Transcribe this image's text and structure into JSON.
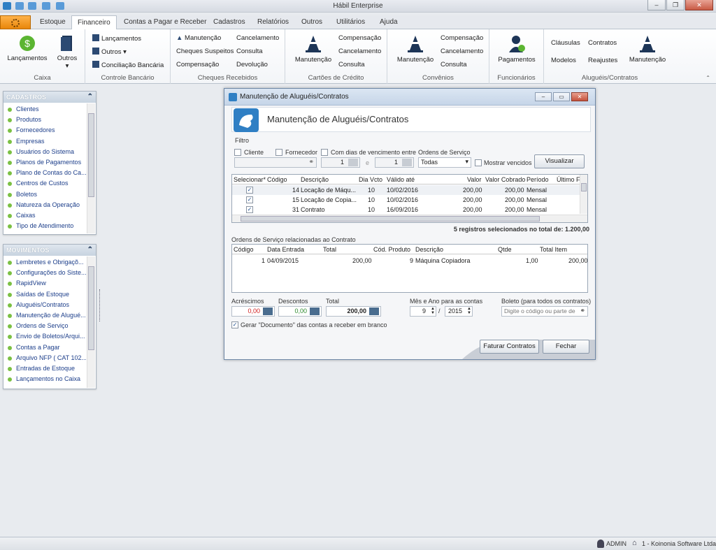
{
  "app": {
    "title": "Hábil Enterprise"
  },
  "menu": {
    "tabs": [
      "Estoque",
      "Financeiro",
      "Contas a Pagar e Receber",
      "Cadastros",
      "Relatórios",
      "Outros",
      "Utilitários",
      "Ajuda"
    ],
    "active": "Financeiro"
  },
  "ribbon": {
    "caixa": {
      "label": "Caixa",
      "lancamentos": "Lançamentos",
      "outros": "Outros"
    },
    "controle": {
      "label": "Controle Bancário",
      "lancamentos": "Lançamentos",
      "outros": "Outros",
      "conciliacao": "Conciliação Bancária"
    },
    "cheques": {
      "label": "Cheques Recebidos",
      "manutencao": "Manutenção",
      "suspeitos": "Cheques Suspeitos",
      "compensacao": "Compensação",
      "cancelamento": "Cancelamento",
      "consulta": "Consulta",
      "devolucao": "Devolução"
    },
    "cartoes": {
      "label": "Cartões de Crédito",
      "manutencao": "Manutenção",
      "compensacao": "Compensação",
      "cancelamento": "Cancelamento",
      "consulta": "Consulta"
    },
    "convenios": {
      "label": "Convênios",
      "manutencao": "Manutenção",
      "compensacao": "Compensação",
      "cancelamento": "Cancelamento",
      "consulta": "Consulta"
    },
    "funcionarios": {
      "label": "Funcionários",
      "pagamentos": "Pagamentos"
    },
    "alugueis": {
      "label": "Aluguéis/Contratos",
      "clausulas": "Cláusulas",
      "modelos": "Modelos",
      "contratos": "Contratos",
      "reajustes": "Reajustes",
      "manutencao": "Manutenção"
    }
  },
  "cadastros": {
    "title": "CADASTROS",
    "items": [
      "Clientes",
      "Produtos",
      "Fornecedores",
      "Empresas",
      "Usuários do Sistema",
      "Planos de Pagamentos",
      "Plano de Contas do Ca...",
      "Centros de Custos",
      "Boletos",
      "Natureza da Operação",
      "Caixas",
      "Tipo de Atendimento"
    ]
  },
  "movimentos": {
    "title": "MOVIMENTOS",
    "items": [
      "Lembretes e Obrigaçõ...",
      "Configurações do Siste...",
      "RapidView",
      "Saídas de Estoque",
      "Aluguéis/Contratos",
      "Manutenção de Alugué...",
      "Ordens de Serviço",
      "Envio de Boletos/Arqui...",
      "Contas a Pagar",
      "Arquivo NFP ( CAT 102...",
      "Entradas de Estoque",
      "Lançamentos no Caixa"
    ]
  },
  "dialog": {
    "title": "Manutenção de Aluguéis/Contratos",
    "header": "Manutenção de Aluguéis/Contratos",
    "filtro": "Filtro",
    "cliente": "Cliente",
    "fornecedor": "Fornecedor",
    "com_dias": "Com dias de vencimento entre",
    "dia_de": "1",
    "dia_e": "e",
    "dia_ate": "1",
    "ordens_label": "Ordens de Serviço",
    "ordens_value": "Todas",
    "mostrar_vencidos": "Mostrar vencidos",
    "visualizar": "Visualizar",
    "contracts": {
      "columns": [
        "Selecionar*",
        "Código",
        "Descrição",
        "Dia Vcto",
        "Válido até",
        "Valor",
        "Valor Cobrado",
        "Período",
        "Último F"
      ],
      "rows": [
        {
          "codigo": "14",
          "descricao": "Locação de Máqu...",
          "dia": "10",
          "valido": "10/02/2016",
          "valor": "200,00",
          "cobrado": "200,00",
          "periodo": "Mensal"
        },
        {
          "codigo": "15",
          "descricao": "Locação de Copia...",
          "dia": "10",
          "valido": "10/02/2016",
          "valor": "200,00",
          "cobrado": "200,00",
          "periodo": "Mensal"
        },
        {
          "codigo": "31",
          "descricao": "Contrato",
          "dia": "10",
          "valido": "16/09/2016",
          "valor": "200,00",
          "cobrado": "200,00",
          "periodo": "Mensal"
        }
      ]
    },
    "summary": "5 registros selecionados no total de: 1.200,00",
    "os_title": "Ordens de Serviço relacionadas ao Contrato",
    "os": {
      "columns": [
        "Código",
        "Data Entrada",
        "Total",
        "Cód. Produto",
        "Descrição",
        "Qtde",
        "Total Item"
      ],
      "rows": [
        {
          "codigo": "1",
          "data": "04/09/2015",
          "total": "200,00",
          "cod_produto": "9",
          "descricao": "Máquina Copiadora",
          "qtde": "1,00",
          "total_item": "200,00"
        }
      ]
    },
    "acrescimos_label": "Acréscimos",
    "acrescimos": "0,00",
    "descontos_label": "Descontos",
    "descontos": "0,00",
    "total_label": "Total",
    "total": "200,00",
    "mes_ano_label": "Mês e Ano para as contas",
    "mes": "9",
    "sep": "/",
    "ano": "2015",
    "boleto_label": "Boleto (para todos os contratos)",
    "boleto_placeholder": "Digite o código ou parte de",
    "gerar": "Gerar \"Documento\" das contas a receber em branco",
    "faturar": "Faturar Contratos",
    "fechar": "Fechar"
  },
  "status": {
    "user": "ADMIN",
    "company": "1 - Koinonia Software Ltda"
  }
}
